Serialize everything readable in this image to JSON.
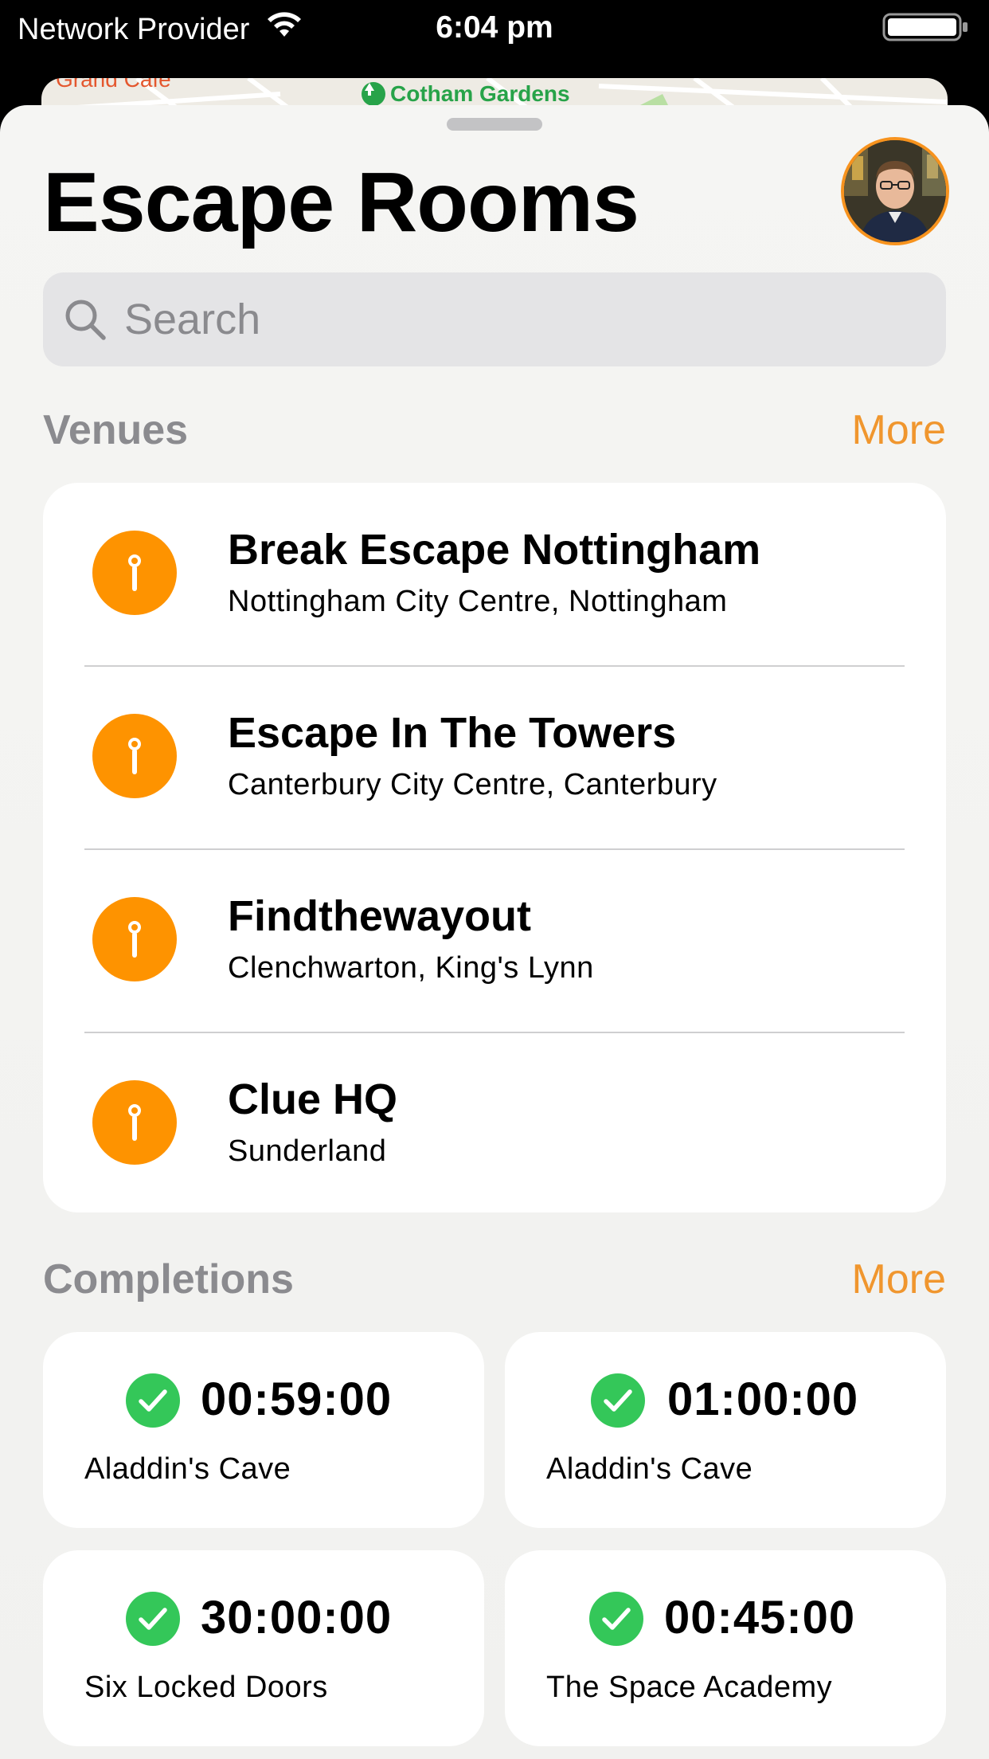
{
  "status_bar": {
    "carrier": "Network Provider",
    "time": "6:04 pm"
  },
  "map": {
    "label_cafe": "Grand Cafe",
    "label_gardens": "Cotham Gardens"
  },
  "header": {
    "title": "Escape Rooms"
  },
  "search": {
    "placeholder": "Search",
    "value": ""
  },
  "venues": {
    "title": "Venues",
    "more_label": "More",
    "items": [
      {
        "name": "Break Escape Nottingham",
        "location": "Nottingham City Centre, Nottingham"
      },
      {
        "name": "Escape In The Towers",
        "location": "Canterbury City Centre, Canterbury"
      },
      {
        "name": "Findthewayout",
        "location": "Clenchwarton, King's Lynn"
      },
      {
        "name": "Clue HQ",
        "location": "Sunderland"
      }
    ]
  },
  "completions": {
    "title": "Completions",
    "more_label": "More",
    "items": [
      {
        "time": "00:59:00",
        "room": "Aladdin's Cave"
      },
      {
        "time": "01:00:00",
        "room": "Aladdin's Cave"
      },
      {
        "time": "30:00:00",
        "room": "Six Locked Doors"
      },
      {
        "time": "00:45:00",
        "room": "The Space Academy"
      }
    ]
  },
  "colors": {
    "accent": "#f0962e",
    "pin": "#fe9300",
    "check": "#34c759",
    "section_title": "#8b8b8f"
  }
}
